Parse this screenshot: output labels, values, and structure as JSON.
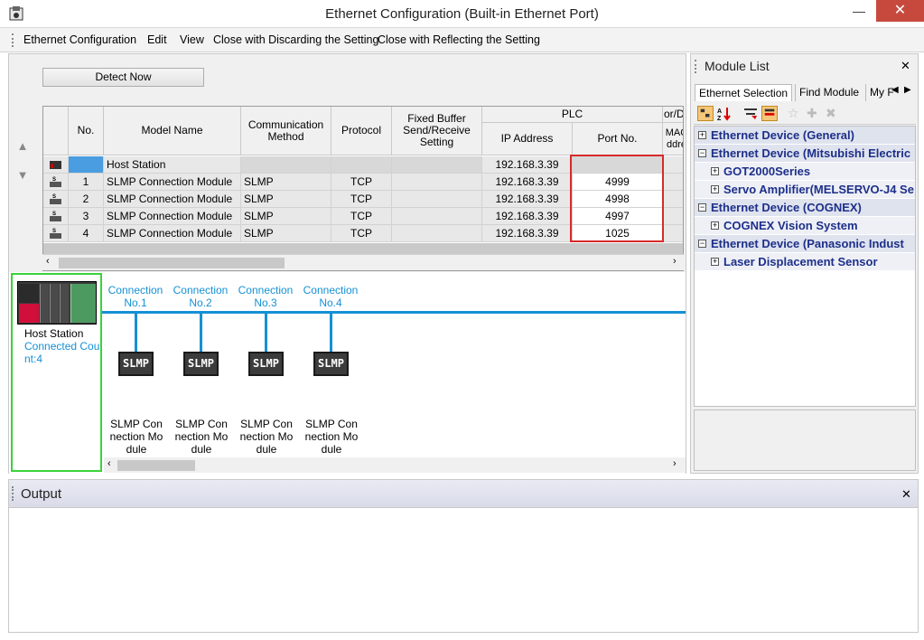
{
  "window": {
    "title": "Ethernet Configuration (Built-in Ethernet Port)",
    "close_glyph": "✕",
    "minimize_glyph": "—"
  },
  "menu": [
    "Ethernet Configuration",
    "Edit",
    "View",
    "Close with Discarding the Setting",
    "Close with Reflecting the Setting"
  ],
  "toolbar": {
    "detect_label": "Detect Now"
  },
  "grid": {
    "headers": {
      "no": "No.",
      "model": "Model Name",
      "comm": "Communication Method",
      "protocol": "Protocol",
      "fixed": "Fixed Buffer Send/Receive Setting",
      "plc": "PLC",
      "ip": "IP Address",
      "port": "Port No.",
      "mac_top": "or/D",
      "mac": "MAC ddre"
    },
    "rows": [
      {
        "no": "",
        "model": "Host Station",
        "comm": "",
        "protocol": "",
        "fixed": "",
        "ip": "192.168.3.39",
        "port": "",
        "icon": "host-station-icon"
      },
      {
        "no": "1",
        "model": "SLMP Connection Module",
        "comm": "SLMP",
        "protocol": "TCP",
        "fixed": "",
        "ip": "192.168.3.39",
        "port": "4999",
        "icon": "slmp-module-icon"
      },
      {
        "no": "2",
        "model": "SLMP Connection Module",
        "comm": "SLMP",
        "protocol": "TCP",
        "fixed": "",
        "ip": "192.168.3.39",
        "port": "4998",
        "icon": "slmp-module-icon"
      },
      {
        "no": "3",
        "model": "SLMP Connection Module",
        "comm": "SLMP",
        "protocol": "TCP",
        "fixed": "",
        "ip": "192.168.3.39",
        "port": "4997",
        "icon": "slmp-module-icon"
      },
      {
        "no": "4",
        "model": "SLMP Connection Module",
        "comm": "SLMP",
        "protocol": "TCP",
        "fixed": "",
        "ip": "192.168.3.39",
        "port": "1025",
        "icon": "slmp-module-icon"
      }
    ]
  },
  "diagram": {
    "host_label": "Host Station",
    "host_count": "Connected Cou nt:4",
    "connections": [
      {
        "label": "Connection No.1",
        "box": "SLMP",
        "name": "SLMP Con nection Mo dule"
      },
      {
        "label": "Connection No.2",
        "box": "SLMP",
        "name": "SLMP Con nection Mo dule"
      },
      {
        "label": "Connection No.3",
        "box": "SLMP",
        "name": "SLMP Con nection Mo dule"
      },
      {
        "label": "Connection No.4",
        "box": "SLMP",
        "name": "SLMP Con nection Mo dule"
      }
    ]
  },
  "module_list": {
    "title": "Module List",
    "close_glyph": "✕",
    "tabs": [
      "Ethernet Selection",
      "Find Module",
      "My F"
    ],
    "tree": [
      {
        "text": "Ethernet Device (General)",
        "level": 0,
        "sign": "+"
      },
      {
        "text": "Ethernet Device (Mitsubishi Electric",
        "level": 0,
        "sign": "−"
      },
      {
        "text": "GOT2000Series",
        "level": 1,
        "sign": "+"
      },
      {
        "text": "Servo Amplifier(MELSERVO-J4 Se",
        "level": 1,
        "sign": "+"
      },
      {
        "text": "Ethernet Device (COGNEX)",
        "level": 0,
        "sign": "−"
      },
      {
        "text": "COGNEX Vision System",
        "level": 1,
        "sign": "+"
      },
      {
        "text": "Ethernet Device (Panasonic Indust",
        "level": 0,
        "sign": "−"
      },
      {
        "text": "Laser Displacement Sensor",
        "level": 1,
        "sign": "+"
      }
    ]
  },
  "output": {
    "title": "Output",
    "close_glyph": "✕"
  },
  "colors": {
    "accent_blue": "#1590d4",
    "highlight_red": "#d72a2a",
    "host_green": "#39d339",
    "tree_text": "#1d2f8a"
  }
}
